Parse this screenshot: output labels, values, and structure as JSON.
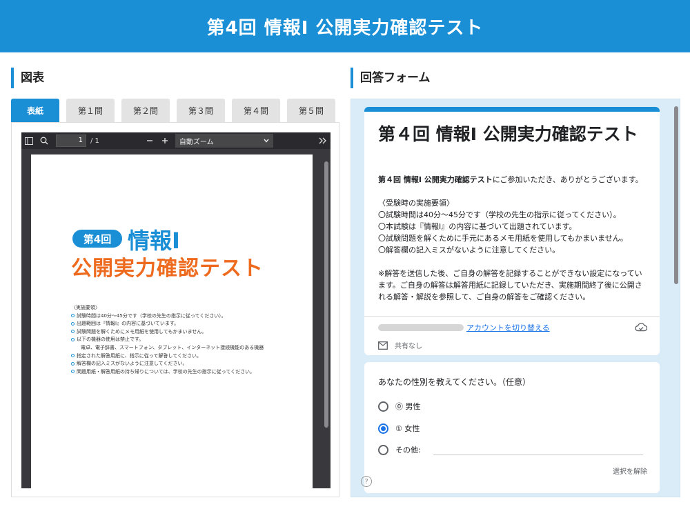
{
  "header": {
    "title": "第4回 情報Ⅰ 公開実力確認テスト"
  },
  "left": {
    "section_title": "図表",
    "tabs": [
      "表紙",
      "第１問",
      "第２問",
      "第３問",
      "第４問",
      "第５問"
    ],
    "viewer": {
      "page_current": "1",
      "page_total": "/ 1",
      "zoom": "自動ズーム",
      "cover": {
        "badge": "第4回",
        "subject": "情報Ⅰ",
        "main_title": "公開実力確認テスト",
        "notes_heading": "〈実施要領〉",
        "notes": [
          "試験時間は40分～45分です（学校の先生の指示に従ってください）。",
          "出題範囲は『情報Ⅰ』の内容に基づいています。",
          "試験問題を解くためにメモ用紙を使用してもかまいません。",
          "以下の機器の使用は禁止です。",
          "電卓、電子辞書、スマートフォン、タブレット、インターネット接続機能のある機器",
          "指定された解答用紙に、指示に従って解答してください。",
          "解答欄の記入ミスがないように注意してください。",
          "問題用紙・解答用紙の持ち帰りについては、学校の先生の指示に従ってください。"
        ]
      }
    }
  },
  "right": {
    "section_title": "回答フォーム",
    "form": {
      "title": "第４回 情報Ⅰ 公開実力確認テスト",
      "intro_bold": "第４回 情報Ⅰ 公開実力確認テスト",
      "intro_rest": "にご参加いただき、ありがとうございます。",
      "rules_heading": "〈受験時の実施要領〉",
      "rules": [
        "〇試験時間は40分～45分です（学校の先生の指示に従ってください）。",
        "〇本試験は『情報Ⅰ』の内容に基づいて出題されています。",
        "〇試験問題を解くために手元にあるメモ用紙を使用してもかまいません。",
        "〇解答欄の記入ミスがないように注意してください。"
      ],
      "note": "※解答を送信した後、ご自身の解答を記録することができない設定になっています。ご自身の解答は解答用紙に記録していただき、実施期間終了後に公開される解答・解説を参照して、ご自身の解答をご確認ください。",
      "switch_account": "アカウントを切り替える",
      "share_status": "共有なし",
      "question": {
        "title": "あなたの性別を教えてください。（任意）",
        "options": [
          "⓪ 男性",
          "① 女性",
          "その他:"
        ],
        "selected_index": 1,
        "clear": "選択を解除"
      }
    }
  },
  "colors": {
    "accent": "#1a8fd6",
    "orange": "#ee6a1e",
    "link": "#1a73e8"
  },
  "icons": [
    "sidebar-toggle-icon",
    "search-icon",
    "zoom-out-icon",
    "zoom-in-icon",
    "chevron-down-icon",
    "double-chevron-right-icon",
    "cloud-icon",
    "mail-icon",
    "help-icon"
  ]
}
